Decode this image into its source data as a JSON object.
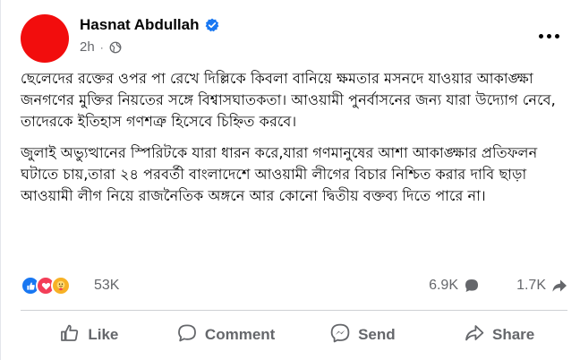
{
  "post": {
    "author": "Hasnat Abdullah",
    "time": "2h",
    "separator": "·",
    "paragraphs": [
      "ছেলেদের রক্তের ওপর পা রেখে দিল্লিকে কিবলা বানিয়ে ক্ষমতার মসনদে যাওয়ার আকাঙ্ক্ষা জনগণের মুক্তির নিয়তের সঙ্গে বিশ্বাসঘাতকতা। আওয়ামী পুনর্বাসনের জন্য যারা উদ্যোগ নেবে, তাদেরকে ইতিহাস গণশত্রু হিসেবে চিহ্নিত করবে।",
      "জুলাই অভ্যুত্থানের স্পিরিটকে যারা ধারন করে,যারা গণমানুষের আশা আকাঙ্ক্ষার প্রতিফলন ঘটাতে চায়,তারা ২৪ পরবর্তী বাংলাদেশে আওয়ামী লীগের বিচার নিশ্চিত করার দাবি ছাড়া আওয়ামী লীগ নিয়ে রাজনৈতিক অঙ্গনে আর কোনো দ্বিতীয় বক্তব্য দিতে পারে না।"
    ]
  },
  "stats": {
    "reactions": "53K",
    "comments": "6.9K",
    "shares": "1.7K"
  },
  "actions": {
    "like": "Like",
    "comment": "Comment",
    "send": "Send",
    "share": "Share"
  },
  "colors": {
    "avatar": "#f20d0d",
    "verified": "#1877f2",
    "like_badge": "#1877f2",
    "love_badge": "#f33e58",
    "care_badge": "#f7b125",
    "secondary_text": "#65676b"
  },
  "icons": {
    "verified": "verified-badge-icon",
    "privacy": "globe-icon",
    "more": "more-options-icon",
    "comments": "comment-bubble-icon",
    "shares": "share-arrow-icon",
    "like": "thumbs-up-icon",
    "comment": "comment-icon",
    "send": "messenger-icon",
    "share": "share-icon"
  }
}
